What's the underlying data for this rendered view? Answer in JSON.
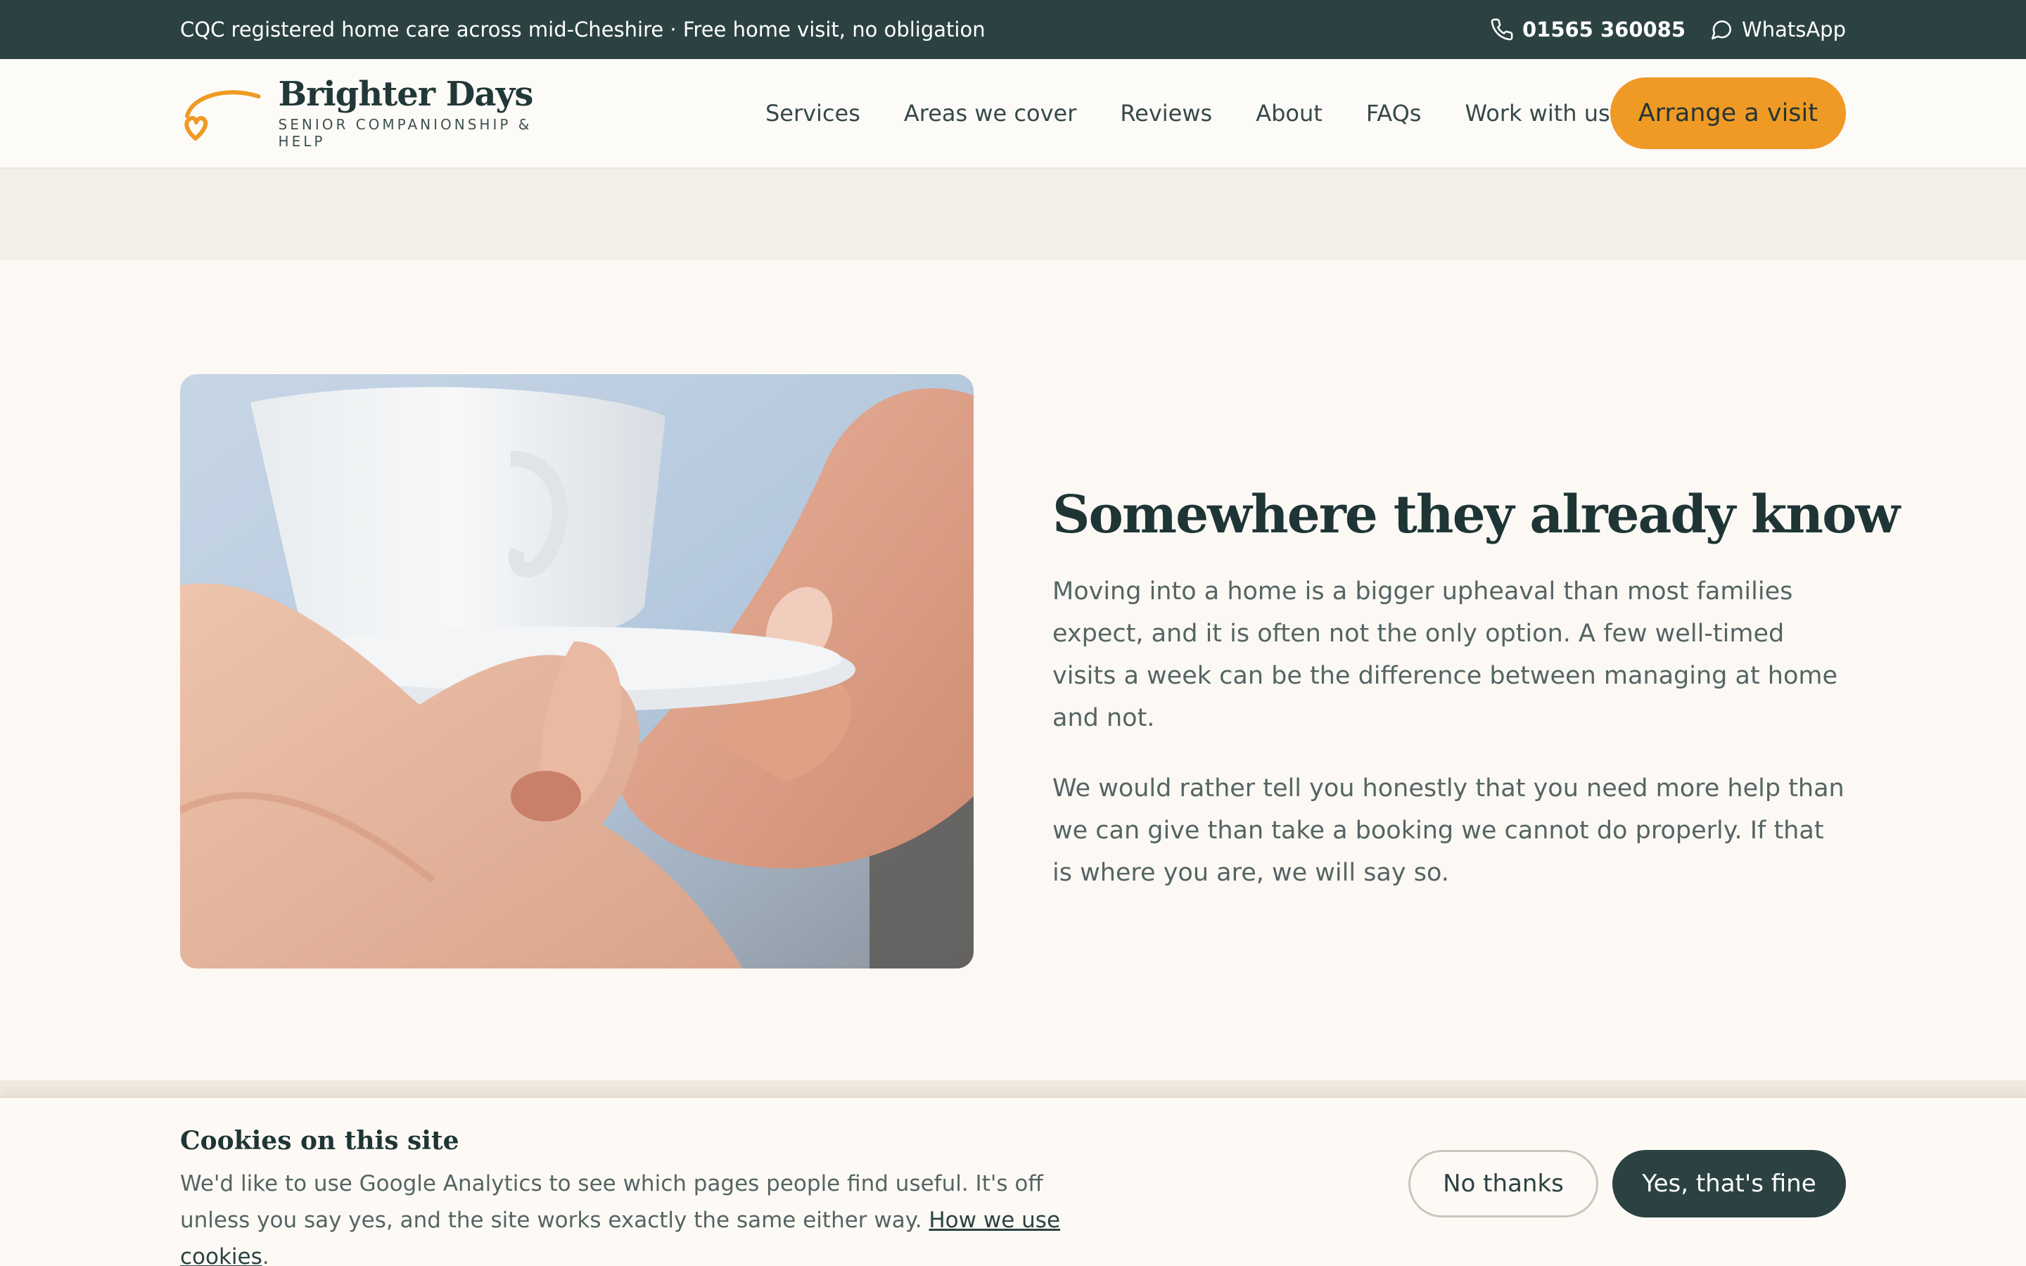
{
  "topbar": {
    "tagline": "CQC registered home care across mid-Cheshire · Free home visit, no obligation",
    "phone": "01565 360085",
    "whatsapp": "WhatsApp",
    "bg_color": "#2c4242"
  },
  "brand": {
    "name": "Brighter Days",
    "tagline": "SENIOR COMPANIONSHIP & HELP",
    "accent_color": "#ef9a24"
  },
  "nav": {
    "items": [
      {
        "label": "Services"
      },
      {
        "label": "Areas we cover"
      },
      {
        "label": "Reviews"
      },
      {
        "label": "About"
      },
      {
        "label": "FAQs"
      },
      {
        "label": "Work with us"
      }
    ],
    "cta": "Arrange a visit"
  },
  "section": {
    "heading": "Somewhere they already know",
    "paragraphs": [
      "Moving into a home is a bigger upheaval than most families expect, and it is often not the only option. A few well-timed visits a week can be the difference between managing at home and not.",
      "We would rather tell you honestly that you need more help than we can give than take a booking we cannot do properly. If that is where you are, we will say so."
    ]
  },
  "cookie": {
    "title": "Cookies on this site",
    "text": "We'd like to use Google Analytics to see which pages people find useful. It's off unless you say yes, and the site works exactly the same either way.",
    "link": "How we use cookies",
    "link_suffix": ".",
    "decline": "No thanks",
    "accept": "Yes, that's fine"
  }
}
